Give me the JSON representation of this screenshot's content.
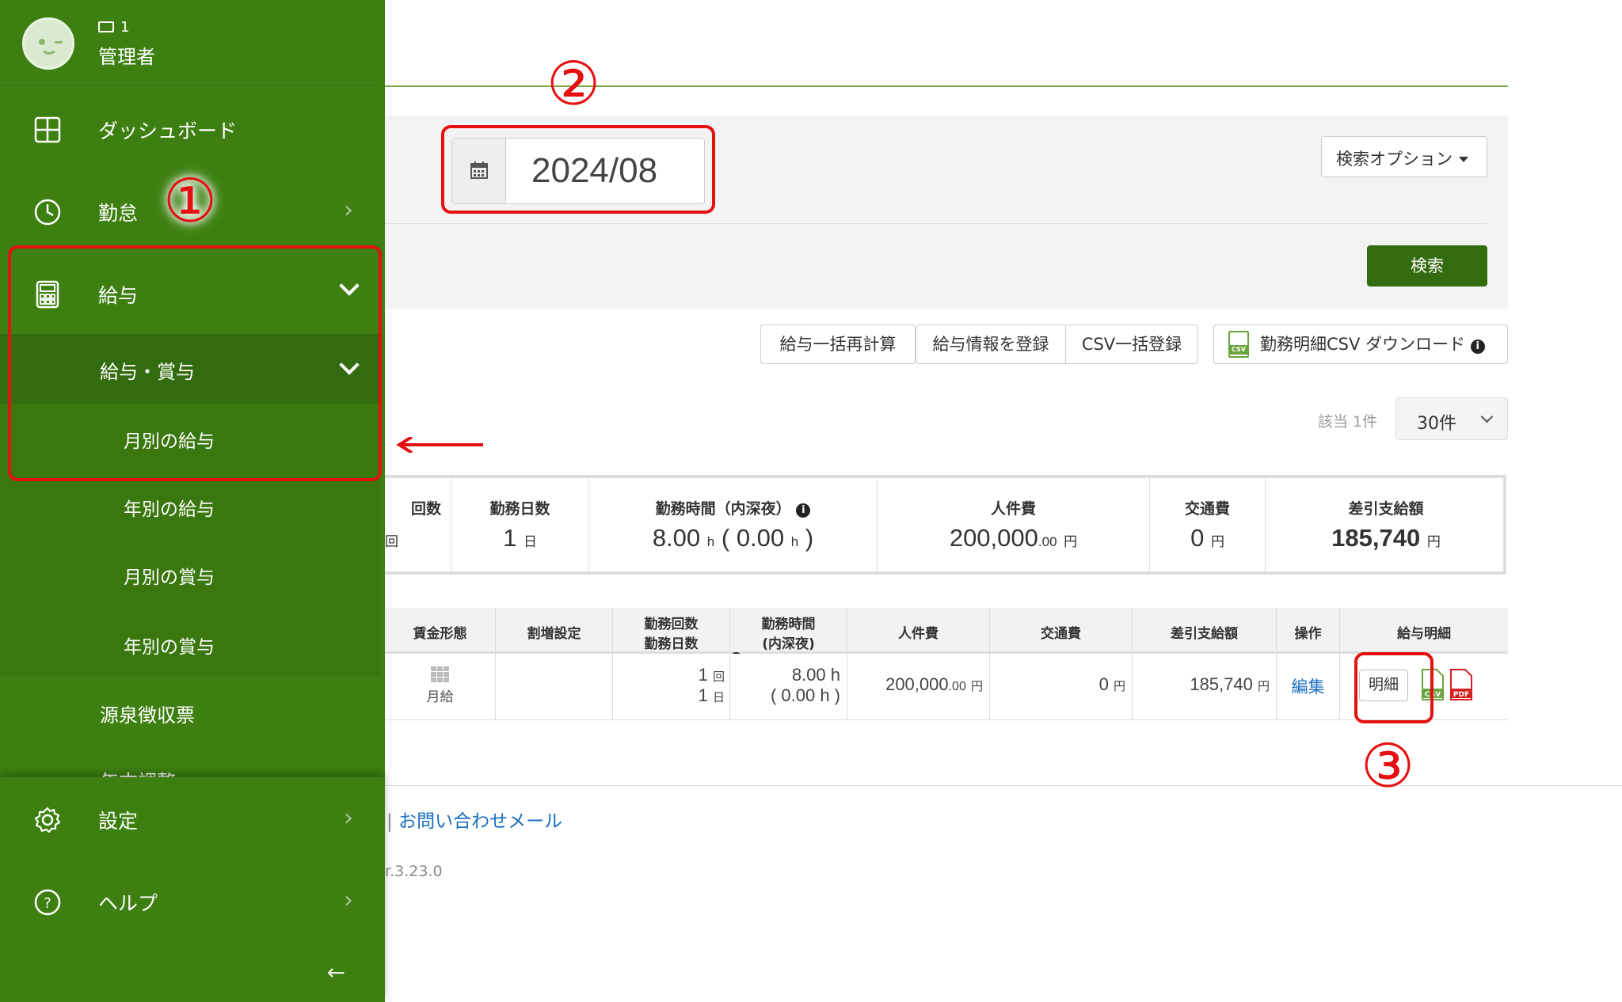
{
  "user": {
    "id": "1",
    "name": "管理者"
  },
  "sidebar": {
    "dashboard": "ダッシュボード",
    "attendance": "勤怠",
    "salary": "給与",
    "salary_bonus": "給与・賞与",
    "monthly_salary": "月別の給与",
    "yearly_salary": "年別の給与",
    "monthly_bonus": "月別の賞与",
    "yearly_bonus": "年別の賞与",
    "withholding": "源泉徴収票",
    "year_end": "年末調整",
    "settings": "設定",
    "help": "ヘルプ"
  },
  "search": {
    "month": "2024/08",
    "options_label": "検索オプション",
    "search_label": "検索"
  },
  "actions": {
    "recalc": "給与一括再計算",
    "register": "給与情報を登録",
    "csv_register": "CSV一括登録",
    "csv_download": "勤務明細CSV ダウンロード",
    "csv_icon": "CSV"
  },
  "pagination": {
    "count": "該当 1件",
    "per_page": "30件"
  },
  "summary": {
    "col1_header": "回数",
    "col1_unit": "回",
    "work_days_header": "勤務日数",
    "work_days_value": "1",
    "work_days_unit": "日",
    "work_hours_header": "勤務時間（内深夜）",
    "work_hours_value": "8.00",
    "work_hours_night": "0.00",
    "hours_unit": "h",
    "labor_cost_header": "人件費",
    "labor_cost_value": "200,000",
    "labor_cost_decimal": ".00",
    "transport_header": "交通費",
    "transport_value": "0",
    "net_header": "差引支給額",
    "net_value": "185,740",
    "yen": "円"
  },
  "table": {
    "headers": {
      "wage_type": "賃金形態",
      "premium": "割増設定",
      "work_count_1": "勤務回数",
      "work_count_2": "勤務日数",
      "work_time_1": "勤務時間",
      "work_time_2": "(内深夜)",
      "labor_cost": "人件費",
      "transport": "交通費",
      "net_pay": "差引支給額",
      "operation": "操作",
      "payslip": "給与明細"
    },
    "row": {
      "wage_type": "月給",
      "work_count": "1",
      "count_unit": "回",
      "work_days": "1",
      "days_unit": "日",
      "work_time": "8.00 h",
      "night_time": "( 0.00 h )",
      "labor_cost": "200,000",
      "labor_cost_decimal": ".00",
      "transport": "0",
      "net_pay": "185,740",
      "yen": "円",
      "edit": "編集",
      "detail": "明細",
      "csv_label": "CSV",
      "pdf_label": "PDF"
    }
  },
  "footer": {
    "contact": "お問い合わせメール",
    "separator": "|",
    "version": "r.3.23.0"
  },
  "annotations": {
    "one": "①",
    "two": "②",
    "three": "③"
  },
  "colors": {
    "sidebar": "#3d8011",
    "primary": "#336c0e",
    "highlight": "#e51010",
    "link": "#1a6ec2"
  }
}
